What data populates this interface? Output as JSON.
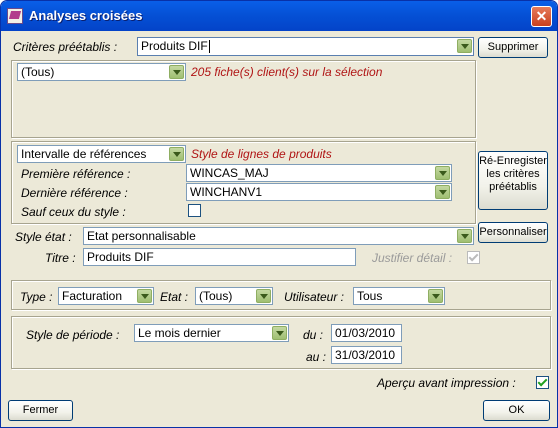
{
  "window": {
    "title": "Analyses croisées",
    "close_symbol": "✕",
    "icon": "app-document-icon"
  },
  "criteres": {
    "label": "Critères préétablis :",
    "value": "Produits DIF",
    "supprimer_label": "Supprimer"
  },
  "clients": {
    "filter_value": "(Tous)",
    "count_text": "205 fiche(s) client(s) sur la sélection"
  },
  "produits": {
    "mode_value": "Intervalle de références",
    "style_label": "Style de lignes de produits",
    "premiere_label": "Première référence :",
    "premiere_value": "WINCAS_MAJ",
    "derniere_label": "Dernière référence :",
    "derniere_value": "WINCHANV1",
    "sauf_label": "Sauf ceux du style :",
    "sauf_checked": false
  },
  "reenregistrer_label": "Ré-Enregister les critères préétablis",
  "etat": {
    "style_label": "Style état :",
    "style_value": "Etat personnalisable",
    "personnaliser_label": "Personnaliser",
    "titre_label": "Titre :",
    "titre_value": "Produits DIF",
    "justifier_label": "Justifier détail :",
    "justifier_checked": true
  },
  "filters": {
    "type_label": "Type :",
    "type_value": "Facturation",
    "etat_label": "Etat :",
    "etat_value": "(Tous)",
    "utilisateur_label": "Utilisateur :",
    "utilisateur_value": "Tous"
  },
  "periode": {
    "style_label": "Style de période :",
    "style_value": "Le mois dernier",
    "du_label": "du :",
    "du_value": "01/03/2010",
    "au_label": "au :",
    "au_value": "31/03/2010"
  },
  "apercu": {
    "label": "Aperçu avant impression :",
    "checked": true
  },
  "buttons": {
    "fermer": "Fermer",
    "ok": "OK"
  }
}
